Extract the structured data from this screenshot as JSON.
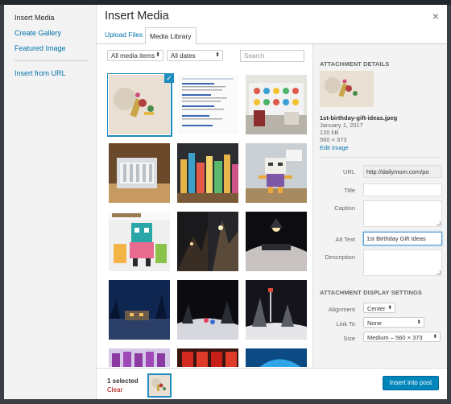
{
  "modal": {
    "title": "Insert Media",
    "close_glyph": "×"
  },
  "menu": {
    "items": [
      "Insert Media",
      "Create Gallery",
      "Featured Image"
    ],
    "url_item": "Insert from URL"
  },
  "tabs": {
    "upload": "Upload Files",
    "library": "Media Library"
  },
  "filters": {
    "type_selected": "All media items",
    "date_selected": "All dates",
    "search_placeholder": "Search"
  },
  "thumbnails": [
    "thumb-image-1-selected",
    "thumb-image-2",
    "thumb-image-3",
    "thumb-image-4",
    "thumb-image-5",
    "thumb-image-6",
    "thumb-image-7",
    "thumb-image-8",
    "thumb-image-9",
    "thumb-image-10",
    "thumb-image-11",
    "thumb-image-12",
    "thumb-image-13",
    "thumb-image-14",
    "thumb-image-15"
  ],
  "details": {
    "heading": "ATTACHMENT DETAILS",
    "filename": "1st-birthday-gift-ideas.jpeg",
    "date": "January 1, 2017",
    "filesize": "120 kB",
    "dimensions": "560 × 373",
    "edit_link": "Edit Image",
    "labels": {
      "url": "URL",
      "title": "Title",
      "caption": "Caption",
      "alt": "Alt Text",
      "description": "Description"
    },
    "values": {
      "url": "http://dailymom.com/po",
      "title": "",
      "caption": "",
      "alt": "1st Birthday Gift Ideas",
      "description": ""
    }
  },
  "display_settings": {
    "heading": "ATTACHMENT DISPLAY SETTINGS",
    "labels": {
      "alignment": "Alignment",
      "link_to": "Link To",
      "size": "Size"
    },
    "values": {
      "alignment": "Center",
      "link_to": "None",
      "size": "Medium – 560 × 373"
    }
  },
  "bottom": {
    "selected_count": "1 selected",
    "clear": "Clear",
    "insert_button": "Insert into post"
  },
  "colors": {
    "accent": "#0085ba",
    "link": "#0073aa",
    "selection": "#1e8cbe",
    "clear": "#a00000"
  }
}
